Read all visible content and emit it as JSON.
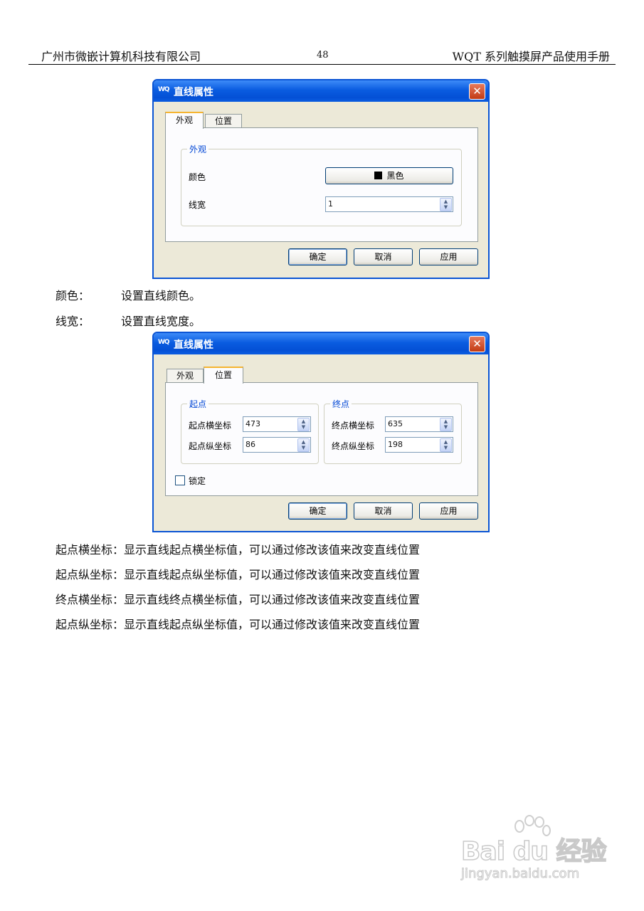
{
  "header": {
    "left": "广州市微嵌计算机科技有限公司",
    "page": "48",
    "right": "WQT 系列触摸屏产品使用手册"
  },
  "dialog1": {
    "title": "直线属性",
    "tabs": [
      "外观",
      "位置"
    ],
    "active_tab": "外观",
    "group_label": "外观",
    "color_label": "颜色",
    "color_value": "黑色",
    "width_label": "线宽",
    "width_value": "1",
    "buttons": {
      "ok": "确定",
      "cancel": "取消",
      "apply": "应用"
    }
  },
  "desc1": [
    {
      "key": "颜色：",
      "text": "设置直线颜色。"
    },
    {
      "key": "线宽：",
      "text": "设置直线宽度。"
    }
  ],
  "dialog2": {
    "title": "直线属性",
    "tabs": [
      "外观",
      "位置"
    ],
    "active_tab": "位置",
    "start_group": "起点",
    "end_group": "终点",
    "start_x_label": "起点横坐标",
    "start_x_value": "473",
    "start_y_label": "起点纵坐标",
    "start_y_value": "86",
    "end_x_label": "终点横坐标",
    "end_x_value": "635",
    "end_y_label": "终点纵坐标",
    "end_y_value": "198",
    "lock_label": "锁定",
    "lock_checked": false,
    "buttons": {
      "ok": "确定",
      "cancel": "取消",
      "apply": "应用"
    }
  },
  "desc2": [
    "起点横坐标：显示直线起点横坐标值，可以通过修改该值来改变直线位置",
    "起点纵坐标：显示直线起点纵坐标值，可以通过修改该值来改变直线位置",
    "终点横坐标：显示直线终点横坐标值，可以通过修改该值来改变直线位置",
    "起点纵坐标：显示直线起点纵坐标值，可以通过修改该值来改变直线位置"
  ],
  "watermark": {
    "main": "Bai du 经验",
    "sub": "jingyan.baidu.com"
  }
}
